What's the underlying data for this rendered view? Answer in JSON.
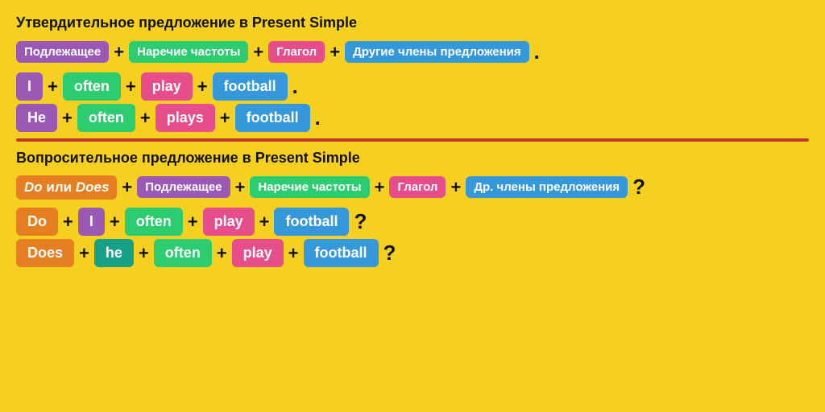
{
  "section1": {
    "title": "Утвердительное предложение в Present Simple",
    "formula": {
      "subject": "Подлежащее",
      "adverb": "Наречие частоты",
      "verb": "Глагол",
      "other": "Другие члены предложения"
    },
    "example1": {
      "subject": "I",
      "adverb": "often",
      "verb": "play",
      "object": "football"
    },
    "example2": {
      "subject": "He",
      "adverb": "often",
      "verb": "plays",
      "object": "football"
    }
  },
  "section2": {
    "title": "Вопросительное предложение в Present Simple",
    "formula": {
      "auxiliary": "Do или Does",
      "subject": "Подлежащее",
      "adverb": "Наречие частоты",
      "verb": "Глагол",
      "other": "Др. члены предложения"
    },
    "example1": {
      "auxiliary": "Do",
      "subject": "I",
      "adverb": "often",
      "verb": "play",
      "object": "football"
    },
    "example2": {
      "auxiliary": "Does",
      "subject": "he",
      "adverb": "often",
      "verb": "play",
      "object": "football"
    }
  },
  "operators": {
    "plus": "+",
    "dot": ".",
    "question": "?"
  }
}
